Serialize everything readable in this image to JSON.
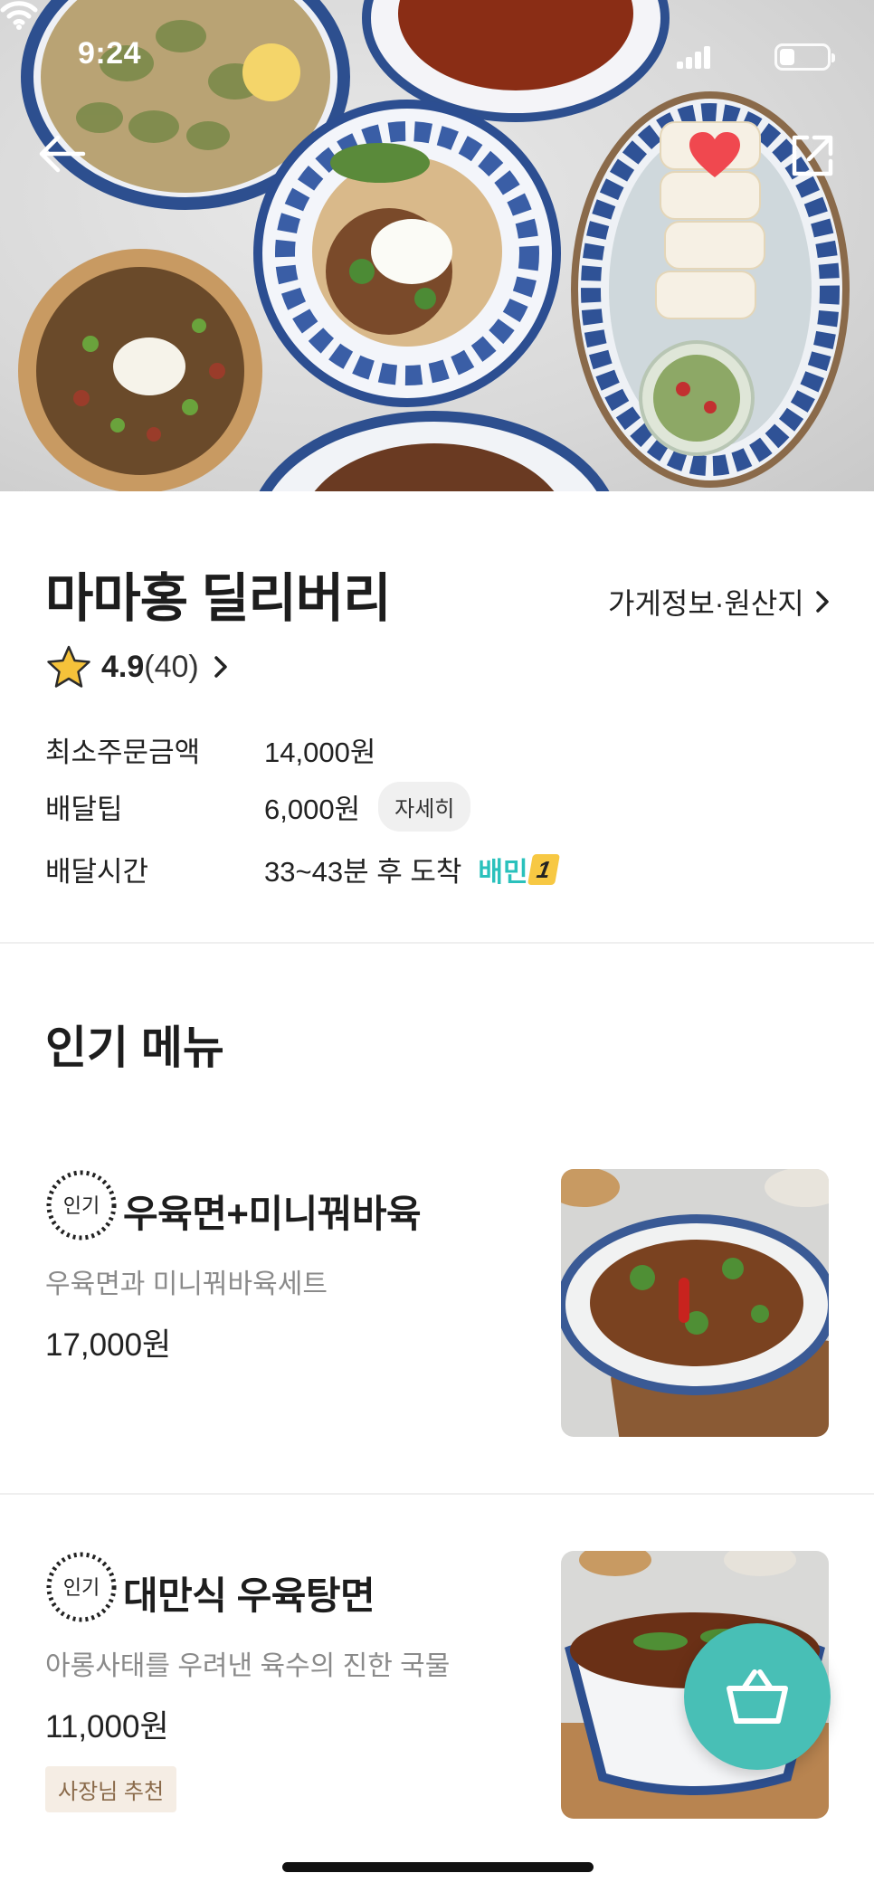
{
  "status_bar": {
    "time": "9:24"
  },
  "header": {
    "back_icon": "arrow-left-icon",
    "favorite_icon": "heart-icon",
    "share_icon": "share-external-icon"
  },
  "store": {
    "name": "마마홍 딜리버리",
    "info_link": "가게정보·원산지",
    "rating": "4.9",
    "review_count": "(40)",
    "min_order_label": "최소주문금액",
    "min_order_value": "14,000원",
    "delivery_tip_label": "배달팁",
    "delivery_tip_value": "6,000원",
    "delivery_tip_detail": "자세히",
    "delivery_time_label": "배달시간",
    "delivery_time_value": "33~43분 후 도착",
    "baemin1_text": "배민",
    "baemin1_number": "1"
  },
  "popular": {
    "title": "인기 메뉴",
    "badge_text": "인기",
    "items": [
      {
        "name": "우육면+미니꿔바육",
        "desc": "우육면과 미니꿔바육세트",
        "price": "17,000원"
      },
      {
        "name": "대만식 우육탕면",
        "desc": "아롱사태를 우려낸 육수의 진한 국물",
        "price": "11,000원",
        "tag": "사장님 추천"
      }
    ]
  },
  "cart": {
    "icon": "shopping-basket-icon"
  },
  "colors": {
    "accent": "#48bfb6",
    "heart": "#f0484f",
    "baemin": "#2ac1bc"
  }
}
